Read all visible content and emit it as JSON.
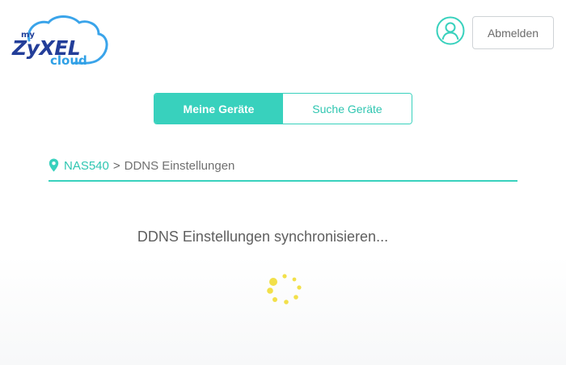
{
  "logo": {
    "my": "my",
    "brand": "ZyXEL",
    "cloud": "cloud"
  },
  "header": {
    "logout_label": "Abmelden"
  },
  "tabs": [
    {
      "label": "Meine Geräte",
      "active": true
    },
    {
      "label": "Suche Geräte",
      "active": false
    }
  ],
  "breadcrumb": {
    "device": "NAS540",
    "separator": ">",
    "current": "DDNS Einstellungen"
  },
  "status": {
    "message": "DDNS Einstellungen synchronisieren..."
  },
  "colors": {
    "accent": "#38d1bd",
    "spinner": "#f2e04a",
    "brand_blue": "#233e99",
    "cloud_blue": "#2fa0e6"
  },
  "icons": {
    "avatar": "user-avatar-icon",
    "pin": "location-pin-icon",
    "spinner": "loading-spinner-icon"
  }
}
